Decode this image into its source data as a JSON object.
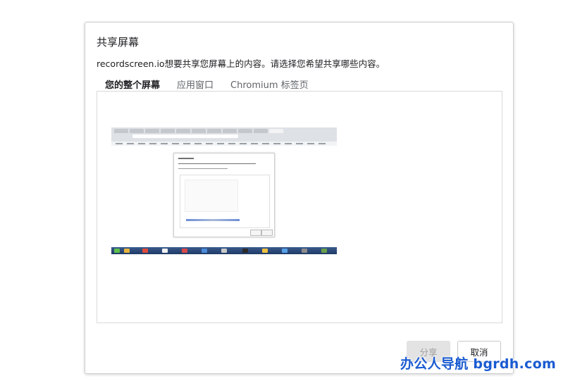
{
  "dialog": {
    "title": "共享屏幕",
    "description": "recordscreen.io想要共享您屏幕上的内容。请选择您希望共享哪些内容。"
  },
  "tabs": [
    {
      "label": "您的整个屏幕",
      "active": true
    },
    {
      "label": "应用窗口",
      "active": false
    },
    {
      "label": "Chromium 标签页",
      "active": false
    }
  ],
  "buttons": {
    "share_label": "分享",
    "cancel_label": "取消"
  },
  "watermark": {
    "text": "办公人导航  bgrdh.com"
  },
  "colors": {
    "watermark": "#1a5bd1",
    "share_disabled_bg": "#e3e3e3",
    "border": "#d9d9d9"
  }
}
